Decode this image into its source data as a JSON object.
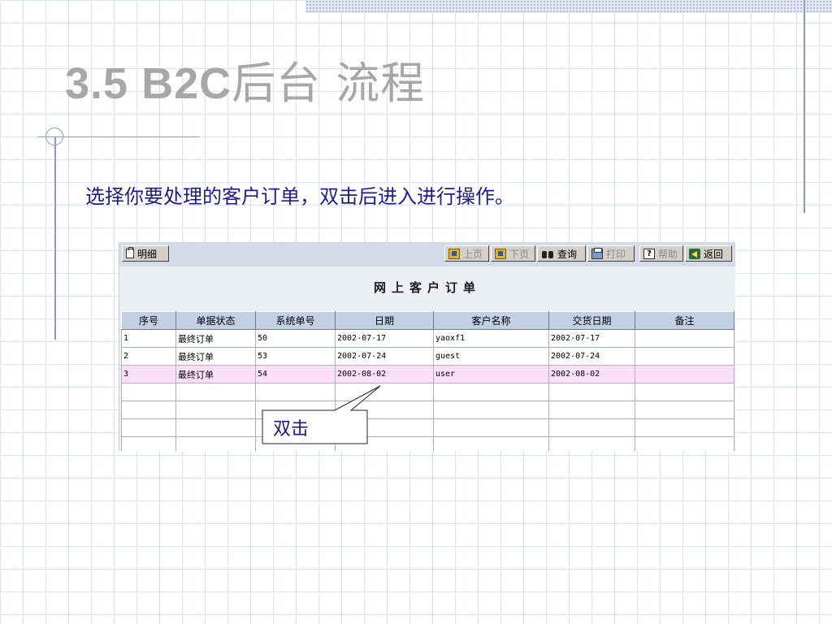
{
  "slide": {
    "title_prefix": "3.5  B2C",
    "title_suffix": "后台 流程",
    "instruction": "选择你要处理的客户订单，双击后进入进行操作。",
    "callout_text": "双击"
  },
  "toolbar": {
    "detail_label": "明细",
    "prev_label": "上页",
    "next_label": "下页",
    "query_label": "查询",
    "print_label": "打印",
    "help_label": "帮助",
    "back_label": "返回"
  },
  "form": {
    "title": "网上客户订单"
  },
  "table": {
    "headers": [
      "序号",
      "单据状态",
      "系统单号",
      "日期",
      "客户名称",
      "交货日期",
      "备注"
    ],
    "rows": [
      [
        "1",
        "最终订单",
        "50",
        "2002-07-17",
        "yaoxf1",
        "2002-07-17",
        ""
      ],
      [
        "2",
        "最终订单",
        "53",
        "2002-07-24",
        "guest",
        "2002-07-24",
        ""
      ],
      [
        "3",
        "最终订单",
        "54",
        "2002-08-02",
        "user",
        "2002-08-02",
        ""
      ]
    ],
    "selected_row": 3
  },
  "colors": {
    "title": "#a7a7a7",
    "instruction": "#1f1c8a",
    "toolbar_bg": "#d4dbe8",
    "header_bg": "#c3cfe3",
    "selected_row_bg": "#fbdff8",
    "accent_line": "#8a9bc6"
  },
  "icons": {
    "detail": "document-icon",
    "prev": "folder-up-icon",
    "next": "folder-down-icon",
    "query": "binoculars-icon",
    "print": "printer-icon",
    "help": "help-icon",
    "back": "exit-door-icon"
  }
}
